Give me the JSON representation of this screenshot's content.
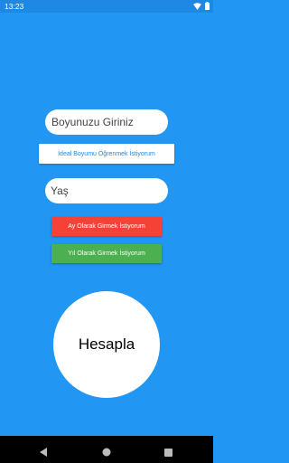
{
  "status_bar": {
    "time": "13:23",
    "icons": [
      "wifi-icon",
      "battery-icon"
    ]
  },
  "height_input": {
    "placeholder": "Boyunuzu Giriniz",
    "value": ""
  },
  "ideal_button": {
    "label": "İdeal Boyumu Öğrenmek İstiyorum"
  },
  "age_input": {
    "placeholder": "Yaş",
    "value": ""
  },
  "month_button": {
    "label": "Ay Olarak Girmek İstiyorum"
  },
  "year_button": {
    "label": "Yıl Olarak Girmek İstiyorum"
  },
  "calculate_button": {
    "label": "Hesapla"
  },
  "nav_bar": {
    "icons": [
      "back-icon",
      "home-icon",
      "recents-icon"
    ]
  },
  "colors": {
    "background": "#2196F3",
    "status_bar": "#1E88E5",
    "month_button": "#F44336",
    "year_button": "#4CAF50",
    "ideal_text": "#1E88E5"
  }
}
